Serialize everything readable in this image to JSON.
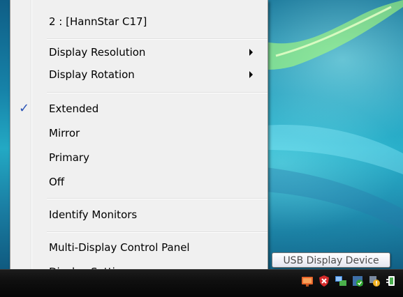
{
  "menu": {
    "header": "2 : [HannStar C17]",
    "items": [
      {
        "label": "Display Resolution",
        "submenu": true
      },
      {
        "label": "Display Rotation",
        "submenu": true
      },
      {
        "label": "Extended",
        "checked": true
      },
      {
        "label": "Mirror"
      },
      {
        "label": "Primary"
      },
      {
        "label": "Off"
      },
      {
        "label": "Identify Monitors"
      },
      {
        "label": "Multi-Display Control Panel"
      },
      {
        "label": "Display Settings..."
      }
    ],
    "check_glyph": "✓"
  },
  "tooltip": {
    "text": "USB Display Device"
  },
  "tray": {
    "icons": [
      "usb-display-icon",
      "security-alert-icon",
      "network-icon",
      "security-check-icon",
      "warning-icon",
      "power-plug-icon"
    ]
  },
  "colors": {
    "menu_bg": "#f0f0f0",
    "check_color": "#2b54b6",
    "taskbar": "#0f0f0f"
  }
}
